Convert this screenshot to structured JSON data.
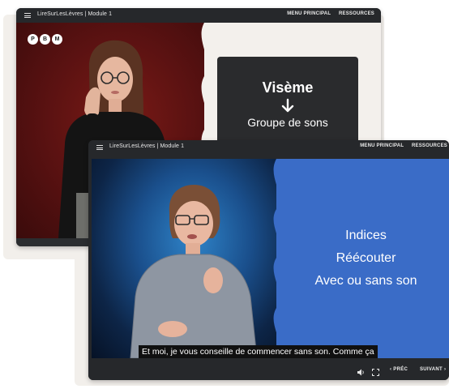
{
  "back_window": {
    "app_title": "LireSurLesLèvres | Module 1",
    "nav": [
      "MENU PRINCIPAL",
      "RESSOURCES"
    ],
    "logo_letters": [
      "P",
      "B",
      "M"
    ],
    "card": {
      "heading": "Visème",
      "arrow": "arrow-down-icon",
      "subheading": "Groupe de sons"
    },
    "colors": {
      "video_bg": "#6b1613",
      "panel_bg": "#f3f0ec",
      "card_bg": "#2a2b2d"
    }
  },
  "front_window": {
    "app_title": "LireSurLesLèvres | Module 1",
    "nav": [
      "MENU PRINCIPAL",
      "RESSOURCES"
    ],
    "overlay_lines": [
      "Indices",
      "Réécouter",
      "Avec ou sans son"
    ],
    "subtitle": "Et moi, je vous conseille de commencer sans son. Comme ça",
    "controls": {
      "volume_icon": "speaker-icon",
      "fullscreen_icon": "fullscreen-icon",
      "prev_label": "PRÉC",
      "next_label": "SUIVANT"
    },
    "colors": {
      "video_bg": "#1a4f8c",
      "panel_bg": "#3a6cc7"
    }
  }
}
